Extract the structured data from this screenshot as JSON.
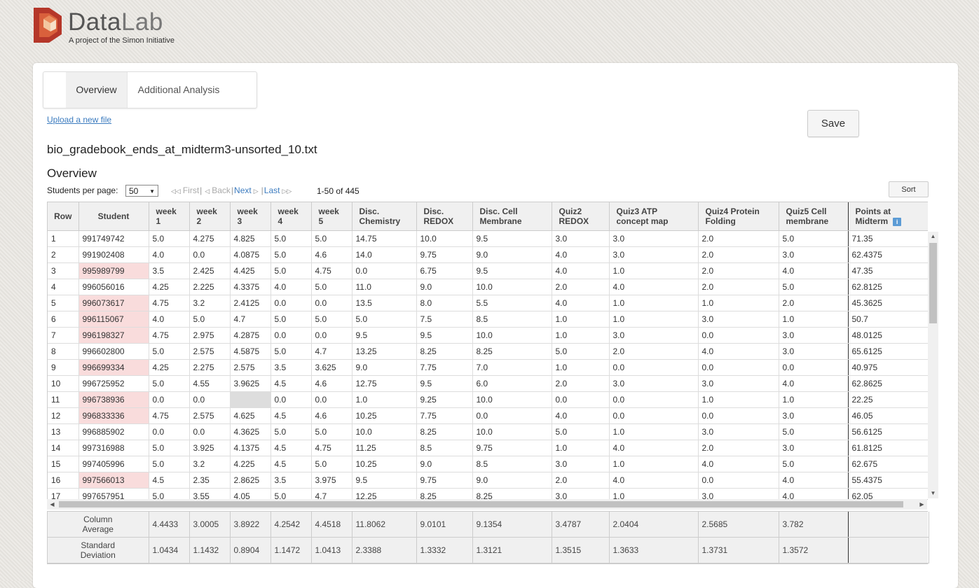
{
  "brand": {
    "name_part1": "Data",
    "name_part2": "Lab",
    "tagline": "A project of the Simon Initiative"
  },
  "tabs": [
    {
      "label": "Overview",
      "active": true
    },
    {
      "label": "Additional Analysis",
      "active": false
    }
  ],
  "upload_link": "Upload a new file",
  "save_label": "Save",
  "filename": "bio_gradebook_ends_at_midterm3-unsorted_10.txt",
  "section_title": "Overview",
  "pagination": {
    "per_page_label": "Students per page:",
    "per_page_value": "50",
    "first": "First",
    "back": "Back",
    "next": "Next",
    "last": "Last",
    "range": "1-50 of 445"
  },
  "sort_label": "Sort",
  "columns": [
    {
      "lines": [
        "Row"
      ]
    },
    {
      "lines": [
        "Student"
      ]
    },
    {
      "lines": [
        "week",
        "1"
      ]
    },
    {
      "lines": [
        "week",
        "2"
      ]
    },
    {
      "lines": [
        "week",
        "3"
      ]
    },
    {
      "lines": [
        "week",
        "4"
      ]
    },
    {
      "lines": [
        "week",
        "5"
      ]
    },
    {
      "lines": [
        "Disc.",
        "Chemistry"
      ]
    },
    {
      "lines": [
        "Disc.",
        "REDOX"
      ]
    },
    {
      "lines": [
        "Disc. Cell",
        "Membrane"
      ]
    },
    {
      "lines": [
        "Quiz2",
        "REDOX"
      ]
    },
    {
      "lines": [
        "Quiz3 ATP",
        "concept map"
      ]
    },
    {
      "lines": [
        "Quiz4 Protein",
        "Folding"
      ]
    },
    {
      "lines": [
        "Quiz5 Cell",
        "membrane"
      ]
    },
    {
      "lines": [
        "Points at",
        "Midterm"
      ],
      "info_icon": true
    }
  ],
  "rows": [
    {
      "flag": false,
      "cells": [
        "1",
        "991749742",
        "5.0",
        "4.275",
        "4.825",
        "5.0",
        "5.0",
        "14.75",
        "10.0",
        "9.5",
        "3.0",
        "3.0",
        "2.0",
        "5.0",
        "71.35"
      ]
    },
    {
      "flag": false,
      "cells": [
        "2",
        "991902408",
        "4.0",
        "0.0",
        "4.0875",
        "5.0",
        "4.6",
        "14.0",
        "9.75",
        "9.0",
        "4.0",
        "3.0",
        "2.0",
        "3.0",
        "62.4375"
      ]
    },
    {
      "flag": true,
      "cells": [
        "3",
        "995989799",
        "3.5",
        "2.425",
        "4.425",
        "5.0",
        "4.75",
        "0.0",
        "6.75",
        "9.5",
        "4.0",
        "1.0",
        "2.0",
        "4.0",
        "47.35"
      ]
    },
    {
      "flag": false,
      "cells": [
        "4",
        "996056016",
        "4.25",
        "2.225",
        "4.3375",
        "4.0",
        "5.0",
        "11.0",
        "9.0",
        "10.0",
        "2.0",
        "4.0",
        "2.0",
        "5.0",
        "62.8125"
      ]
    },
    {
      "flag": true,
      "cells": [
        "5",
        "996073617",
        "4.75",
        "3.2",
        "2.4125",
        "0.0",
        "0.0",
        "13.5",
        "8.0",
        "5.5",
        "4.0",
        "1.0",
        "1.0",
        "2.0",
        "45.3625"
      ]
    },
    {
      "flag": true,
      "cells": [
        "6",
        "996115067",
        "4.0",
        "5.0",
        "4.7",
        "5.0",
        "5.0",
        "5.0",
        "7.5",
        "8.5",
        "1.0",
        "1.0",
        "3.0",
        "1.0",
        "50.7"
      ]
    },
    {
      "flag": true,
      "cells": [
        "7",
        "996198327",
        "4.75",
        "2.975",
        "4.2875",
        "0.0",
        "0.0",
        "9.5",
        "9.5",
        "10.0",
        "1.0",
        "3.0",
        "0.0",
        "3.0",
        "48.0125"
      ]
    },
    {
      "flag": false,
      "cells": [
        "8",
        "996602800",
        "5.0",
        "2.575",
        "4.5875",
        "5.0",
        "4.7",
        "13.25",
        "8.25",
        "8.25",
        "5.0",
        "2.0",
        "4.0",
        "3.0",
        "65.6125"
      ]
    },
    {
      "flag": true,
      "cells": [
        "9",
        "996699334",
        "4.25",
        "2.275",
        "2.575",
        "3.5",
        "3.625",
        "9.0",
        "7.75",
        "7.0",
        "1.0",
        "0.0",
        "0.0",
        "0.0",
        "40.975"
      ]
    },
    {
      "flag": false,
      "cells": [
        "10",
        "996725952",
        "5.0",
        "4.55",
        "3.9625",
        "4.5",
        "4.6",
        "12.75",
        "9.5",
        "6.0",
        "2.0",
        "3.0",
        "3.0",
        "4.0",
        "62.8625"
      ]
    },
    {
      "flag": true,
      "cells": [
        "11",
        "996738936",
        "0.0",
        "0.0",
        "",
        "0.0",
        "0.0",
        "1.0",
        "9.25",
        "10.0",
        "0.0",
        "0.0",
        "1.0",
        "1.0",
        "22.25"
      ]
    },
    {
      "flag": true,
      "cells": [
        "12",
        "996833336",
        "4.75",
        "2.575",
        "4.625",
        "4.5",
        "4.6",
        "10.25",
        "7.75",
        "0.0",
        "4.0",
        "0.0",
        "0.0",
        "3.0",
        "46.05"
      ]
    },
    {
      "flag": false,
      "cells": [
        "13",
        "996885902",
        "0.0",
        "0.0",
        "4.3625",
        "5.0",
        "5.0",
        "10.0",
        "8.25",
        "10.0",
        "5.0",
        "1.0",
        "3.0",
        "5.0",
        "56.6125"
      ]
    },
    {
      "flag": false,
      "cells": [
        "14",
        "997316988",
        "5.0",
        "3.925",
        "4.1375",
        "4.5",
        "4.75",
        "11.25",
        "8.5",
        "9.75",
        "1.0",
        "4.0",
        "2.0",
        "3.0",
        "61.8125"
      ]
    },
    {
      "flag": false,
      "cells": [
        "15",
        "997405996",
        "5.0",
        "3.2",
        "4.225",
        "4.5",
        "5.0",
        "10.25",
        "9.0",
        "8.5",
        "3.0",
        "1.0",
        "4.0",
        "5.0",
        "62.675"
      ]
    },
    {
      "flag": true,
      "cells": [
        "16",
        "997566013",
        "4.5",
        "2.35",
        "2.8625",
        "3.5",
        "3.975",
        "9.5",
        "9.75",
        "9.0",
        "2.0",
        "4.0",
        "0.0",
        "4.0",
        "55.4375"
      ]
    },
    {
      "flag": false,
      "cells": [
        "17",
        "997657951",
        "5.0",
        "3.55",
        "4.05",
        "5.0",
        "4.7",
        "12.25",
        "8.25",
        "8.25",
        "3.0",
        "1.0",
        "3.0",
        "4.0",
        "62.05"
      ]
    }
  ],
  "stats": [
    {
      "label_lines": [
        "Column",
        "Average"
      ],
      "values": [
        "4.4433",
        "3.0005",
        "3.8922",
        "4.2542",
        "4.4518",
        "11.8062",
        "9.0101",
        "9.1354",
        "3.4787",
        "2.0404",
        "2.5685",
        "3.782",
        ""
      ]
    },
    {
      "label_lines": [
        "Standard",
        "Deviation"
      ],
      "values": [
        "1.0434",
        "1.1432",
        "0.8904",
        "1.1472",
        "1.0413",
        "2.3388",
        "1.3332",
        "1.3121",
        "1.3515",
        "1.3633",
        "1.3731",
        "1.3572",
        ""
      ]
    }
  ],
  "colors": {
    "accent_link": "#3b7bbf",
    "flag_bg": "#f9dcdc",
    "logo_red": "#b5372a"
  }
}
